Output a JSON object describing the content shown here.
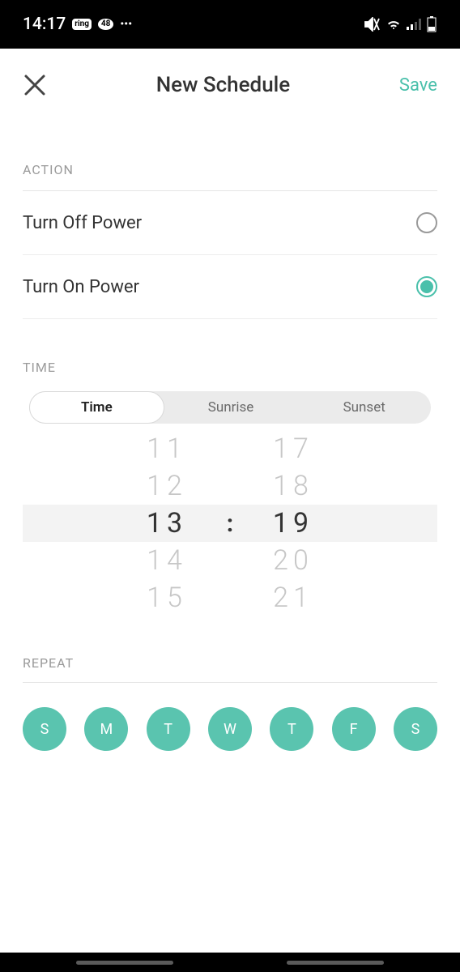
{
  "status": {
    "time": "14:17",
    "ring_badge": "ring",
    "count_badge": "48",
    "dots": "•••"
  },
  "nav": {
    "title": "New Schedule",
    "save": "Save"
  },
  "sections": {
    "action_label": "ACTION",
    "time_label": "TIME",
    "repeat_label": "REPEAT"
  },
  "actions": {
    "off": "Turn Off Power",
    "on": "Turn On Power",
    "selected": "on"
  },
  "time_mode": {
    "segments": [
      "Time",
      "Sunrise",
      "Sunset"
    ],
    "active": 0
  },
  "picker": {
    "hours": [
      "11",
      "12",
      "13",
      "14",
      "15"
    ],
    "minutes": [
      "17",
      "18",
      "19",
      "20",
      "21"
    ],
    "sep": ":",
    "selected_hour": "13",
    "selected_minute": "19"
  },
  "repeat": {
    "days": [
      "S",
      "M",
      "T",
      "W",
      "T",
      "F",
      "S"
    ],
    "selected": [
      true,
      true,
      true,
      true,
      true,
      true,
      true
    ]
  }
}
